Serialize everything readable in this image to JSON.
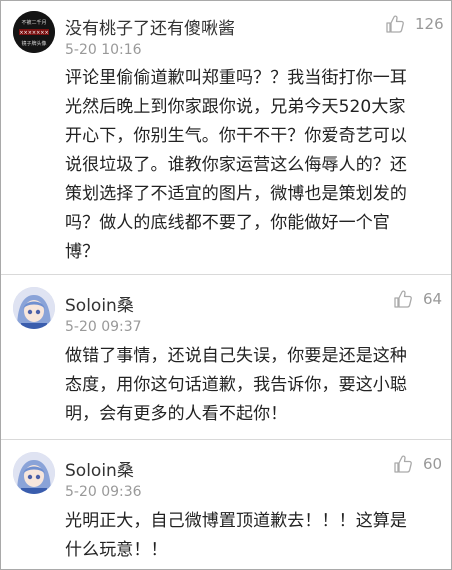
{
  "comments": [
    {
      "username": "没有桃子了还有傻啾酱",
      "time": "5-20 10:16",
      "likes": "126",
      "avatar_text": [
        "不被二千月",
        "×××××××",
        "镜子牌头像"
      ],
      "text_lines": [
        "评论里偷偷道歉叫郑重吗？？我当街打你一耳",
        "光然后晚上到你家跟你说，兄弟今天520大家",
        "开心下，你别生气。你干不干？你爱奇艺可以",
        "说很垃圾了。谁教你家运营这么侮辱人的？还",
        "策划选择了不适宜的图片，微博也是策划发的",
        "吗？做人的底线都不要了，你能做好一个官",
        "博？"
      ]
    },
    {
      "username": "Soloin桑",
      "time": "5-20 09:37",
      "likes": "64",
      "text_lines": [
        "做错了事情，还说自己失误，你要是还是这种",
        "态度，用你这句话道歉，我告诉你，要这小聪",
        "明，会有更多的人看不起你！"
      ]
    },
    {
      "username": "Soloin桑",
      "time": "5-20 09:36",
      "likes": "60",
      "text_lines": [
        "光明正大，自己微博置顶道歉去！！！这算是",
        "什么玩意！！"
      ]
    }
  ],
  "colors": {
    "text": "#222222",
    "meta": "#999999",
    "divider": "#d9d9d9"
  },
  "icons": {
    "like": "thumbs-up-icon"
  }
}
